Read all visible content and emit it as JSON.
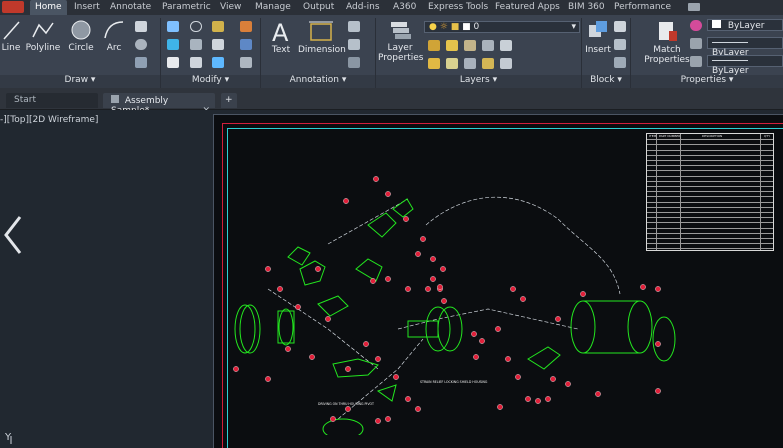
{
  "ribbon_tabs": [
    "Home",
    "Insert",
    "Annotate",
    "Parametric",
    "View",
    "Manage",
    "Output",
    "Add-ins",
    "A360",
    "Express Tools",
    "Featured Apps",
    "BIM 360",
    "Performance"
  ],
  "active_tab": "Home",
  "draw": {
    "line": "Line",
    "polyline": "Polyline",
    "circle": "Circle",
    "arc": "Arc",
    "group": "Draw"
  },
  "modify": {
    "group": "Modify"
  },
  "annotation": {
    "text": "Text",
    "dimension": "Dimension",
    "group": "Annotation"
  },
  "layers": {
    "layer_properties_line1": "Layer",
    "layer_properties_line2": "Properties",
    "current_layer": "0",
    "group": "Layers"
  },
  "block": {
    "insert": "Insert",
    "group": "Block"
  },
  "properties": {
    "match_line1": "Match",
    "match_line2": "Properties",
    "color": "ByLayer",
    "linetype": "ByLayer",
    "lineweight": "ByLayer",
    "group": "Properties"
  },
  "doc_tabs": {
    "start": "Start",
    "assembly": "Assembly Sample*",
    "plus": "+"
  },
  "viewport_label": "-][Top][2D Wireframe]",
  "ucs_label": "Y",
  "bom_header": [
    "ITEM",
    "PART NUMBER",
    "DESCRIPTION",
    "QTY"
  ],
  "drawing_notes": [
    "DRIVING ON THRU HOUSING PIVOT",
    "STRAIN RELIEF LOCKING SHIELD HOUSING"
  ],
  "colors": {
    "accent_green": "#23e61f",
    "callout_red": "#e0203a",
    "sheet_border": "#d21f3c",
    "sheet_cyan": "#2ad0d5",
    "ribbon_bg": "#3b4350"
  }
}
